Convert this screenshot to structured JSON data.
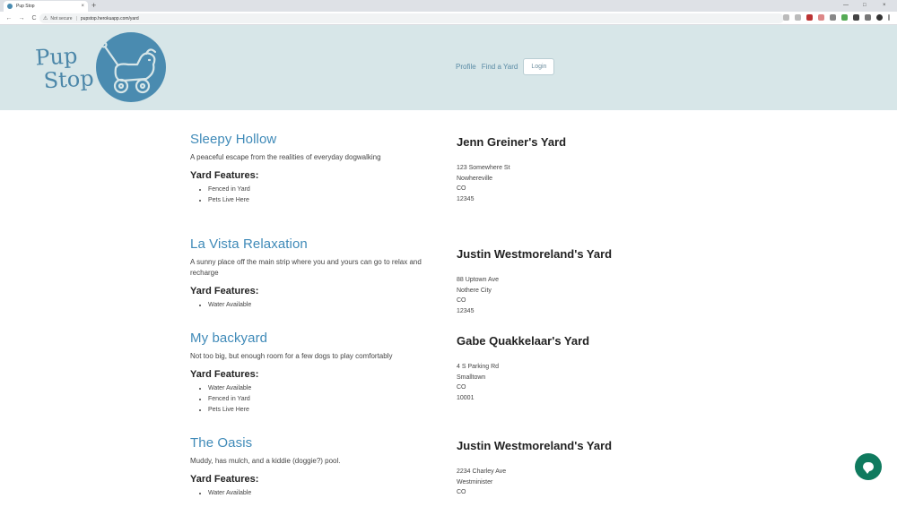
{
  "browser": {
    "tab_title": "Pup Stop",
    "tab_close": "×",
    "new_tab": "+",
    "minimize": "—",
    "maximize": "□",
    "close": "×",
    "back": "←",
    "forward": "→",
    "reload": "C",
    "security_label": "Not secure",
    "url": "pupstop.herokuapp.com/yard"
  },
  "header": {
    "logo_line1": "Pup",
    "logo_line2": "Stop",
    "nav_profile": "Profile",
    "nav_find": "Find a Yard",
    "nav_login": "Login"
  },
  "features_heading": "Yard Features:",
  "yards": [
    {
      "name": "Sleepy Hollow",
      "description": "A peaceful escape from the realities of everyday dogwalking",
      "features": [
        "Fenced in Yard",
        "Pets Live Here"
      ],
      "owner": "Jenn Greiner's Yard",
      "address": [
        "123 Somewhere St",
        "Nowhereville",
        "CO",
        "12345"
      ]
    },
    {
      "name": "La Vista Relaxation",
      "description": "A sunny place off the main strip where you and yours can go to relax and recharge",
      "features": [
        "Water Available"
      ],
      "owner": "Justin Westmoreland's Yard",
      "address": [
        "88 Uptown Ave",
        "Nothere City",
        "CO",
        "12345"
      ]
    },
    {
      "name": "My backyard",
      "description": "Not too big, but enough room for a few dogs to play comfortably",
      "features": [
        "Water Available",
        "Fenced in Yard",
        "Pets Live Here"
      ],
      "owner": "Gabe Quakkelaar's Yard",
      "address": [
        "4 S Parking Rd",
        "Smalltown",
        "CO",
        "10001"
      ]
    },
    {
      "name": "The Oasis",
      "description": "Muddy, has mulch, and a kiddie (doggie?) pool.",
      "features": [
        "Water Available"
      ],
      "owner": "Justin Westmoreland's Yard",
      "address": [
        "2234 Charley Ave",
        "Westminister",
        "CO"
      ]
    }
  ],
  "colors": {
    "header_bg": "#d7e6e8",
    "accent_blue": "#3f8ab8",
    "logo_blue": "#4a8bb0",
    "chat_green": "#0f7a5e"
  }
}
